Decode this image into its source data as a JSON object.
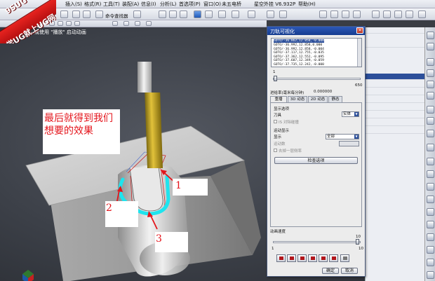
{
  "menu": {
    "items": [
      "插入(S)",
      "格式(R)",
      "工具(T)",
      "装配(A)",
      "信息(I)",
      "分析(L)",
      "首选项(P)",
      "窗口(O)",
      "  未五电桥",
      "星空外挂 V6.932P",
      "帮助(H)"
    ]
  },
  "toolbar": {
    "command_finder_label": "命令查找器"
  },
  "status_message": "定义刀具，或使用 \"播放\" 启动动画",
  "logo": {
    "line1": "9SUG",
    "line2": "学UG就上UG网"
  },
  "annotation": {
    "line1": "最后就得到我们",
    "line2": "想要的效果"
  },
  "labels": {
    "one": "1",
    "two": "2",
    "three": "3"
  },
  "dialog": {
    "title": "刀轨可视化",
    "goto_lines": [
      "GOTO/-36.862,12.858,-0.000",
      "GOTO/-36.992,12.858,0.000",
      "GOTO/-36.992,12.858,-0.004",
      "GOTO/-37.117,12.755,-0.035",
      "GOTO/-37.362,12.552,-0.095",
      "GOTO/-37.607,12.349,-0.059",
      "GOTO/-37.735,12.242,-0.000"
    ],
    "pos_slider": {
      "min": "1",
      "max": "650"
    },
    "feed_rate_label": "进给率(毫米每分钟)",
    "feed_rate_value": "0.000000",
    "tabs": [
      "重播",
      "3D 动态",
      "2D 动态",
      "静态"
    ],
    "display_options_label": "显示选项",
    "tool_label": "刀具",
    "tool_value": "实体",
    "collision_label": "IS 对除碰撞",
    "motion_display_label": "运动显示",
    "display_label": "显示",
    "display_value": "全部",
    "motion_count_label": "运动数",
    "prev_layer_label": "去掉一层侧率",
    "check_options_button": "检查选项",
    "animation_speed_label": "动画速度",
    "speed_min": "1",
    "speed_max": "10",
    "speed_current": "10",
    "ok_button": "确定",
    "cancel_button": "取消"
  }
}
